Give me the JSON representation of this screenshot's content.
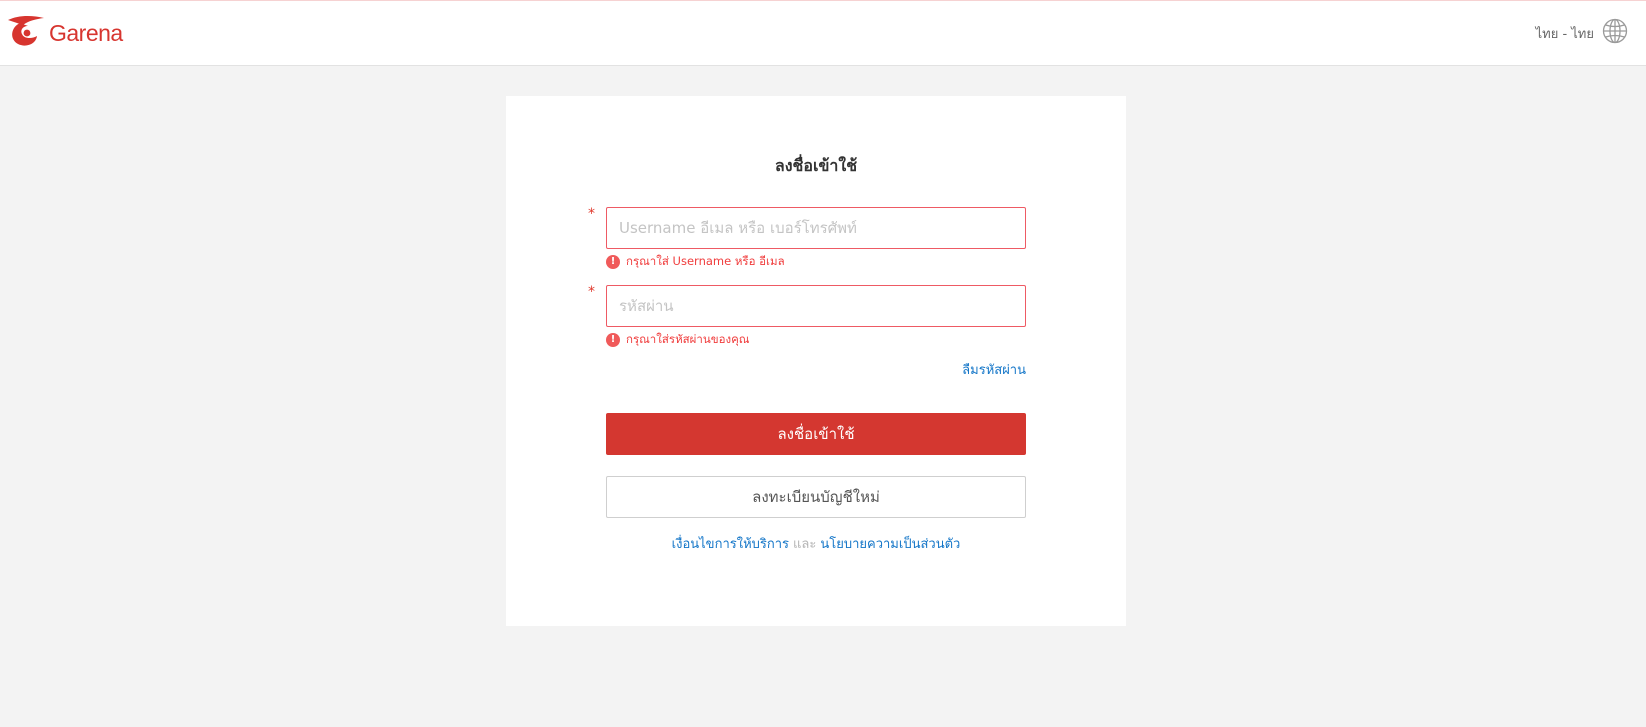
{
  "header": {
    "logo_text": "Garena",
    "language_label": "ไทย - ไทย",
    "language_icon": "globe-icon",
    "brand_color": "#d7352f"
  },
  "form": {
    "title": "ลงชื่อเข้าใช้",
    "required_mark": "*",
    "username": {
      "value": "",
      "placeholder": "Username อีเมล หรือ เบอร์โทรศัพท์",
      "error": "กรุณาใส่ Username หรือ อีเมล"
    },
    "password": {
      "value": "",
      "placeholder": "รหัสผ่าน",
      "error": "กรุณาใส่รหัสผ่านของคุณ"
    },
    "error_icon_glyph": "!",
    "forgot_password": "ลืมรหัสผ่าน",
    "login_button": "ลงชื่อเข้าใช้",
    "register_button": "ลงทะเบียนบัญชีใหม่",
    "legal": {
      "terms": "เงื่อนไขการให้บริการ",
      "and": "และ",
      "privacy": "นโยบายความเป็นส่วนตัว"
    }
  },
  "colors": {
    "primary_button": "#d43730",
    "error": "#f03c3c",
    "link": "#1476c8",
    "page_background": "#f3f3f3"
  }
}
